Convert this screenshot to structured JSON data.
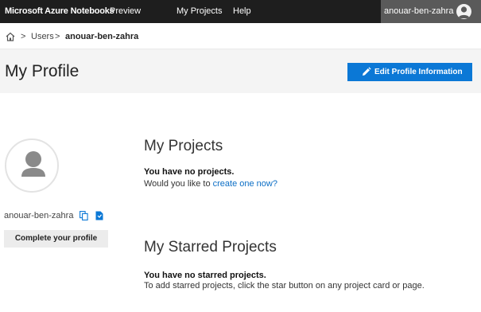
{
  "topbar": {
    "brand": "Microsoft Azure Notebooks",
    "preview": "Preview",
    "nav_projects": "My Projects",
    "nav_help": "Help",
    "user_name": "anouar-ben-zahra"
  },
  "breadcrumb": {
    "sep": ">",
    "users": "Users",
    "current": "anouar-ben-zahra"
  },
  "header": {
    "title": "My Profile",
    "edit_button": "Edit Profile Information"
  },
  "profile": {
    "name": "anouar-ben-zahra",
    "complete_button": "Complete your profile"
  },
  "projects": {
    "title": "My Projects",
    "empty_bold": "You have no projects.",
    "empty_prefix": "Would you like to ",
    "create_link": "create one now?"
  },
  "starred": {
    "title": "My Starred Projects",
    "empty_bold": "You have no starred projects.",
    "empty_text": "To add starred projects, click the star button on any project card or page."
  },
  "colors": {
    "topbar": "#1e1e1e",
    "user_menu": "#5a5a5a",
    "accent": "#0b78d6",
    "link": "#0b6ec5"
  },
  "icons": [
    "home-icon",
    "user-avatar-icon",
    "pencil-icon",
    "copy-icon",
    "document-icon"
  ]
}
